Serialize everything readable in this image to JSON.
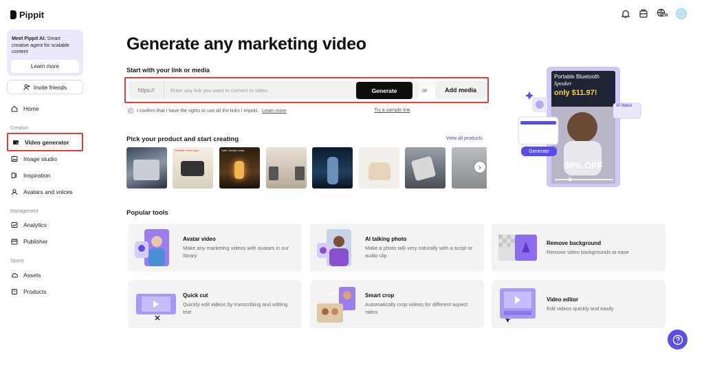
{
  "app": {
    "name": "Pippit"
  },
  "sidebar": {
    "promo": {
      "title": "Meet Pippit AI:",
      "text": " Smart creative agent for scalable content",
      "button": "Learn more"
    },
    "invite": "Invite friends",
    "home": "Home",
    "section_creation": "Creation",
    "items_creation": [
      "Video generator",
      "Image studio",
      "Inspiration",
      "Avatars and voices"
    ],
    "section_management": "Management",
    "items_management": [
      "Analytics",
      "Publisher"
    ],
    "section_space": "Space",
    "items_space": [
      "Assets",
      "Products"
    ]
  },
  "header": {
    "language": "EN"
  },
  "main": {
    "title": "Generate any marketing video",
    "subtitle": "Start with your link or media",
    "link_prefix": "https://",
    "link_placeholder": "Enter any link you want to convert to video",
    "generate_button": "Generate",
    "or": "or",
    "add_media": "Add media",
    "confirm_text": "I confirm that I have the rights to use all the links I import.",
    "learn_more": "Learn more",
    "sample_link": "Try a sample link",
    "pick_title": "Pick your product and start creating",
    "view_all": "View all products",
    "thumb_labels": [
      "",
      "Portable Home gym",
      "Safe Candle Lamp",
      "",
      "",
      "",
      "",
      ""
    ]
  },
  "hero": {
    "product": "Portable Bluetooth",
    "product_em": "Speaker",
    "price": "only $11.97!",
    "ai_voice": "AI Voice",
    "generate": "Generate",
    "discount": "30% OFF"
  },
  "popular": {
    "title": "Popular tools",
    "tools": [
      {
        "title": "Avatar video",
        "desc": "Make any marketing videos with avatars in our library"
      },
      {
        "title": "AI talking photo",
        "desc": "Make a photo talk very naturally with a script or audio clip"
      },
      {
        "title": "Remove background",
        "desc": "Remove video backgrounds at ease"
      },
      {
        "title": "Quick cut",
        "desc": "Quickly edit videos by transcribing and editing text"
      },
      {
        "title": "Smart crop",
        "desc": "Automatically crop videos for different aspect ratios"
      },
      {
        "title": "Video editor",
        "desc": "Edit videos quickly and easily"
      }
    ]
  },
  "colors": {
    "accent": "#5b4ee8",
    "highlight": "#e23b3b",
    "promo_bg": "#ece8fb"
  }
}
